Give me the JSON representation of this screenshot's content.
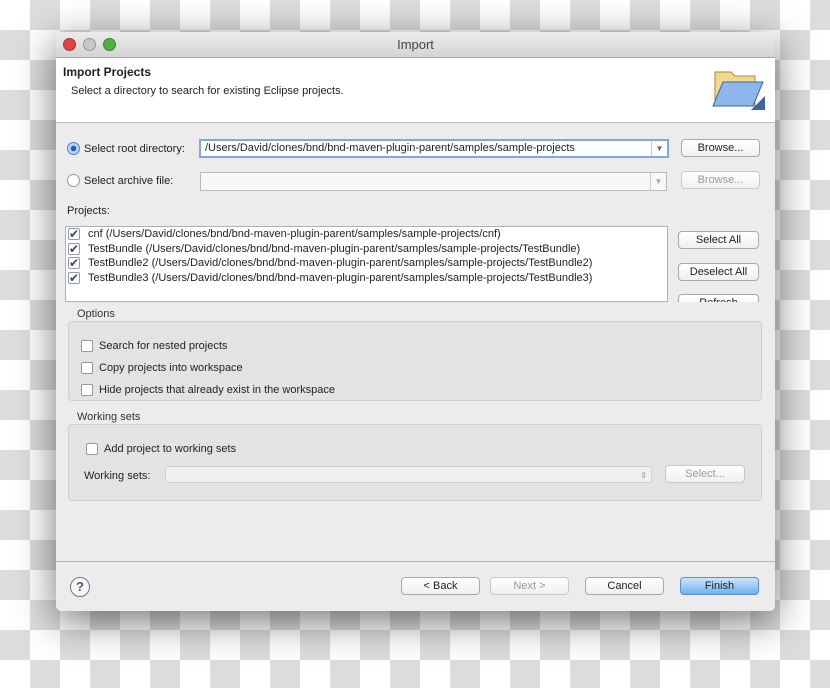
{
  "window": {
    "title": "Import"
  },
  "header": {
    "title": "Import Projects",
    "subtitle": "Select a directory to search for existing Eclipse projects.",
    "icon": "folder-open-icon"
  },
  "source": {
    "root_label": "Select root directory:",
    "root_value": "/Users/David/clones/bnd/bnd-maven-plugin-parent/samples/sample-projects",
    "root_selected": true,
    "archive_label": "Select archive file:",
    "archive_value": "",
    "archive_selected": false,
    "browse_label": "Browse..."
  },
  "projects": {
    "label": "Projects:",
    "items": [
      {
        "label": "cnf (/Users/David/clones/bnd/bnd-maven-plugin-parent/samples/sample-projects/cnf)",
        "checked": true
      },
      {
        "label": "TestBundle (/Users/David/clones/bnd/bnd-maven-plugin-parent/samples/sample-projects/TestBundle)",
        "checked": true
      },
      {
        "label": "TestBundle2 (/Users/David/clones/bnd/bnd-maven-plugin-parent/samples/sample-projects/TestBundle2)",
        "checked": true
      },
      {
        "label": "TestBundle3 (/Users/David/clones/bnd/bnd-maven-plugin-parent/samples/sample-projects/TestBundle3)",
        "checked": true
      }
    ],
    "select_all": "Select All",
    "deselect_all": "Deselect All",
    "refresh": "Refresh"
  },
  "options": {
    "label": "Options",
    "items": [
      {
        "label": "Search for nested projects",
        "checked": false
      },
      {
        "label": "Copy projects into workspace",
        "checked": false
      },
      {
        "label": "Hide projects that already exist in the workspace",
        "checked": false
      }
    ]
  },
  "working_sets": {
    "label": "Working sets",
    "add_label": "Add project to working sets",
    "add_checked": false,
    "field_label": "Working sets:",
    "field_value": "",
    "select_label": "Select..."
  },
  "footer": {
    "back": "< Back",
    "next": "Next >",
    "cancel": "Cancel",
    "finish": "Finish",
    "help_icon": "help-icon"
  },
  "colors": {
    "accent": "#6cb0f0",
    "close": "#e0443e",
    "minimize": "#c8c8c8",
    "zoom": "#4fb23f"
  }
}
